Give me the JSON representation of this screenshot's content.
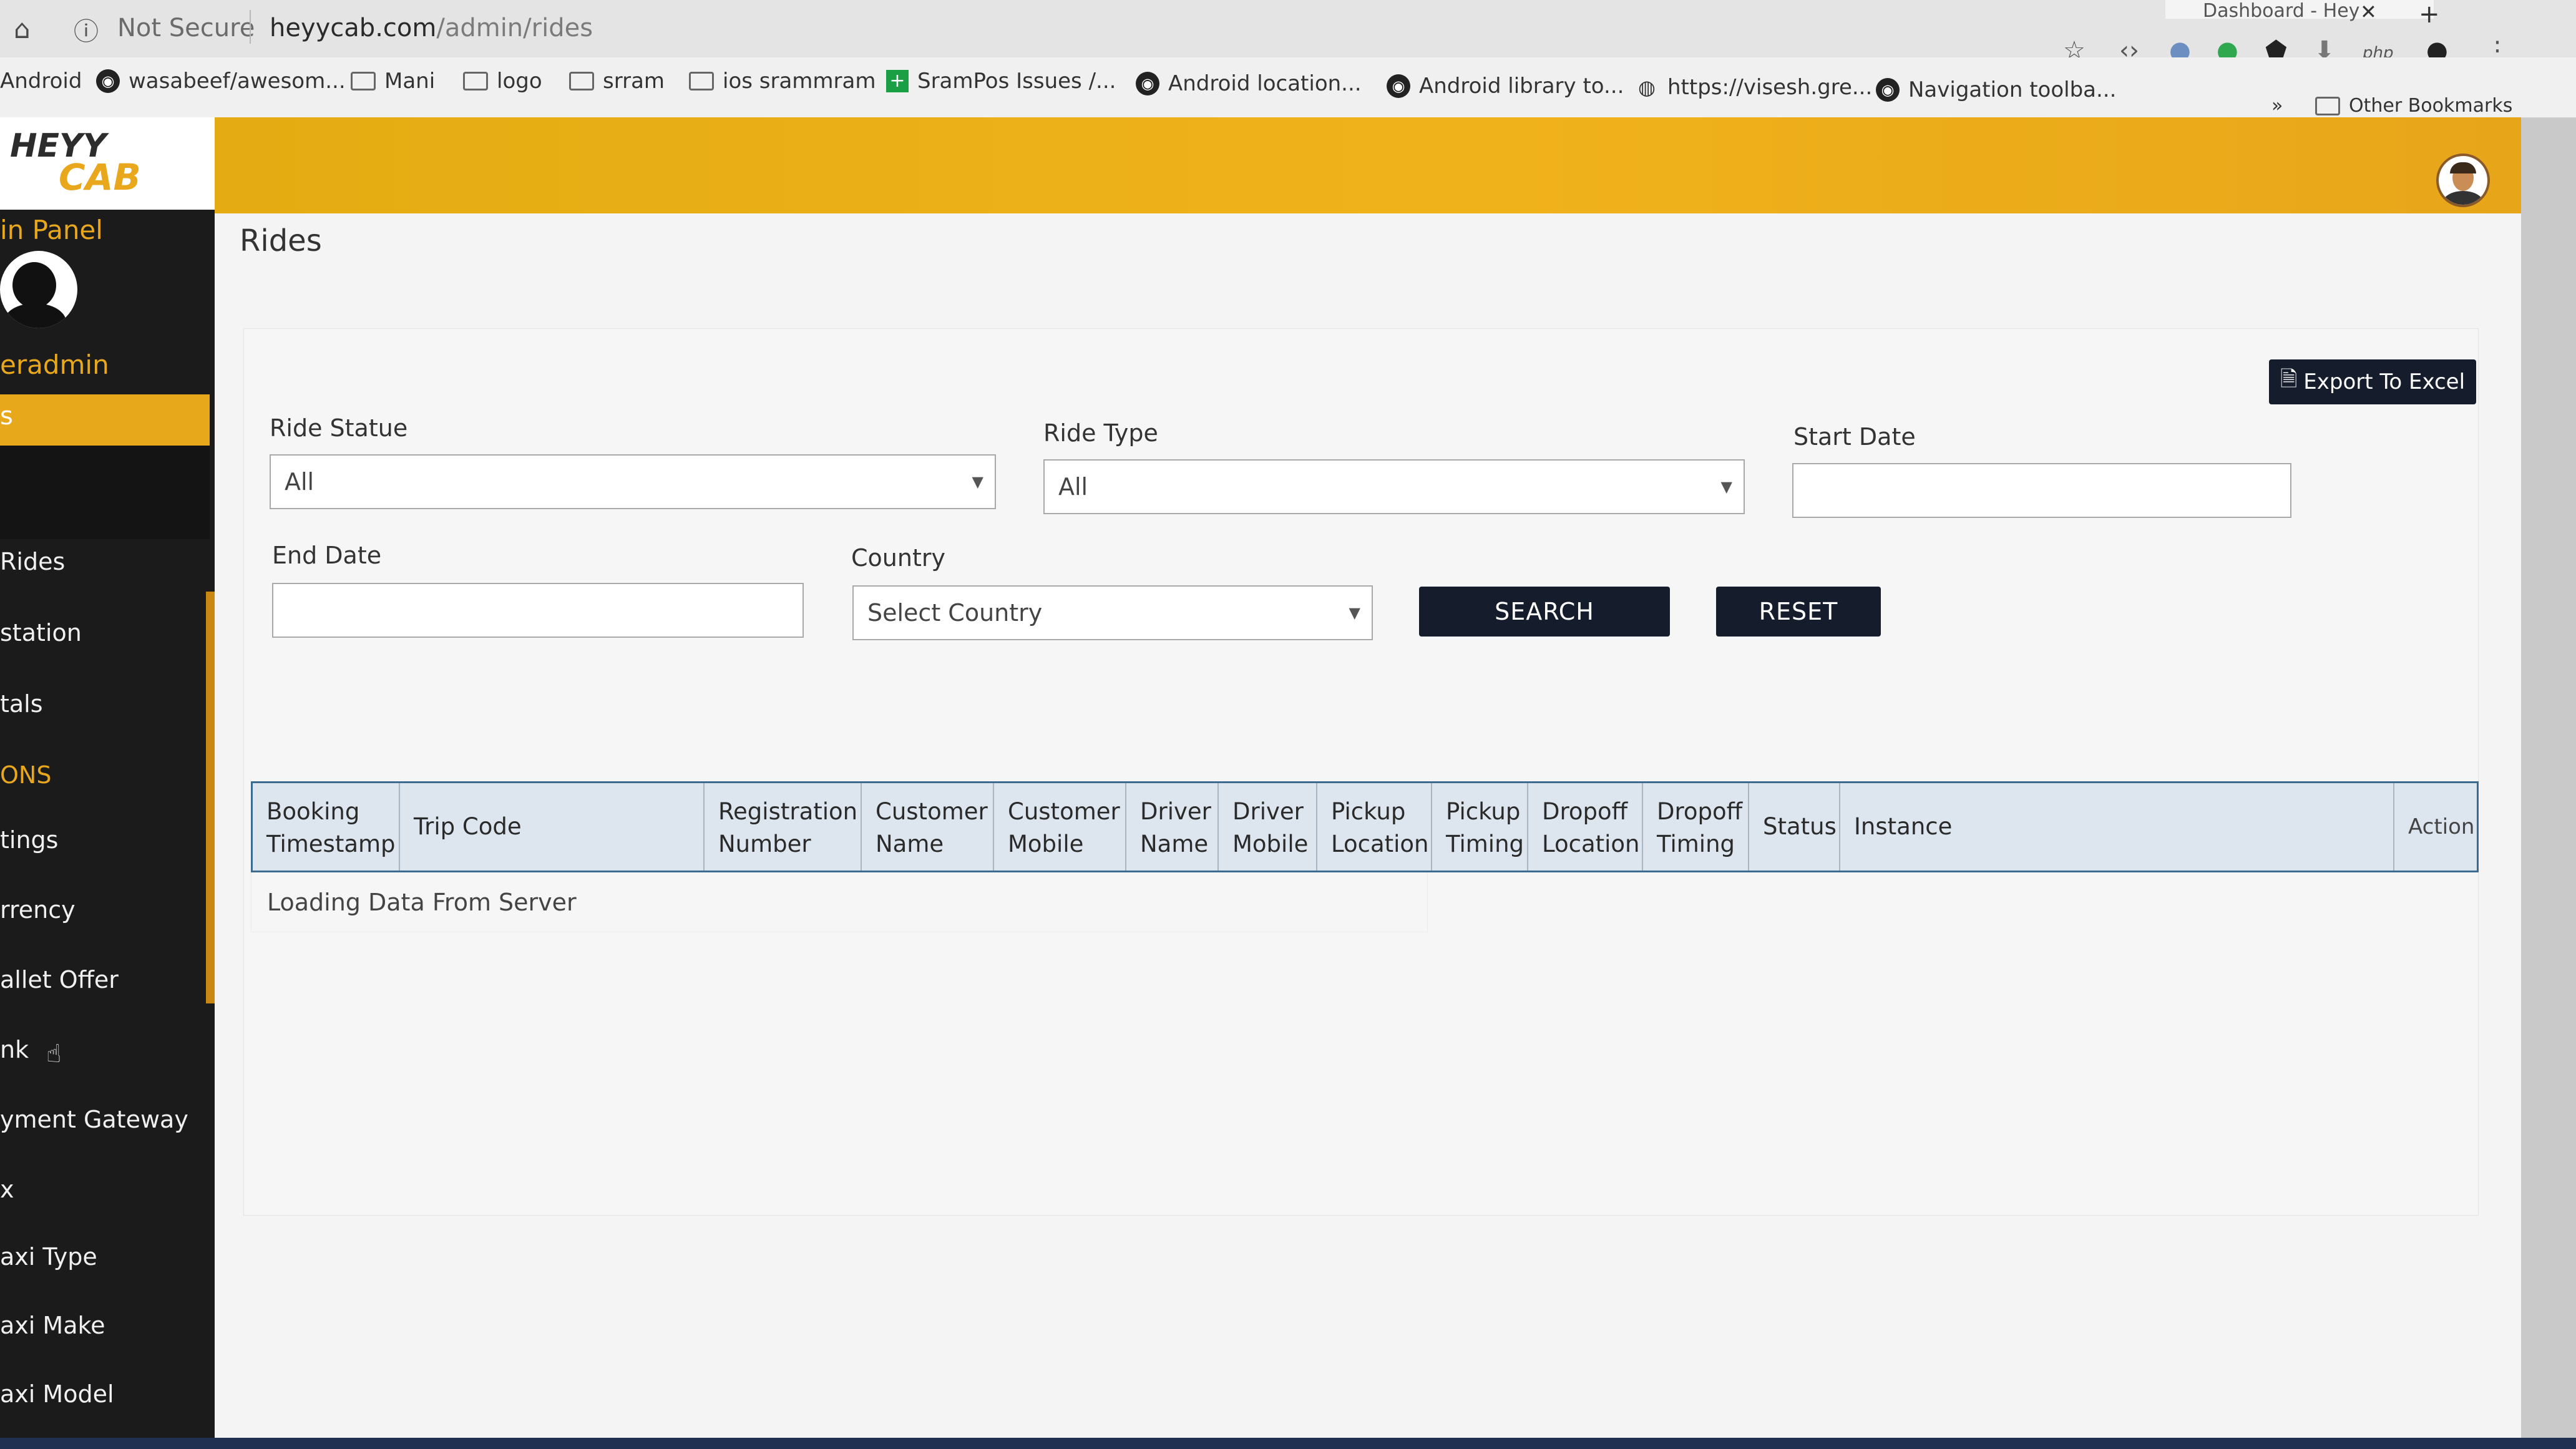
{
  "browser": {
    "security_label": "Not Secure",
    "url_host": "heyycab.com",
    "url_path": "/admin/rides",
    "active_tab_title": "Dashboard - Hey",
    "tab_close": "✕",
    "new_tab": "+"
  },
  "bookmarks": [
    {
      "label": "Android",
      "icon": "none"
    },
    {
      "label": "wasabeef/awesom...",
      "icon": "github-icon"
    },
    {
      "label": "Mani",
      "icon": "folder-icon"
    },
    {
      "label": "logo",
      "icon": "folder-icon"
    },
    {
      "label": "srram",
      "icon": "folder-icon"
    },
    {
      "label": "ios srammram",
      "icon": "folder-icon"
    },
    {
      "label": "SramPos Issues /...",
      "icon": "sheets-icon"
    },
    {
      "label": "Android location...",
      "icon": "github-icon"
    },
    {
      "label": "Android library to...",
      "icon": "github-icon"
    },
    {
      "label": "https://visesh.gre...",
      "icon": "globe-icon"
    },
    {
      "label": "Navigation toolba...",
      "icon": "github-icon"
    }
  ],
  "bookmarks_overflow": "»",
  "other_bookmarks": "Other Bookmarks",
  "extensions": {
    "php_label": "php"
  },
  "app": {
    "logo_top": "HEYY",
    "logo_bottom": "CAB",
    "panel_title": "in Panel",
    "username": "eradmin",
    "active_menu": "s",
    "menu": [
      {
        "label": "Rides",
        "color": "#f0f0f0"
      },
      {
        "label": "station",
        "color": "#f0f0f0"
      },
      {
        "label": "tals",
        "color": "#f0f0f0"
      },
      {
        "label": "ONS",
        "color": "#e9a81c"
      },
      {
        "label": "tings",
        "color": "#f0f0f0"
      },
      {
        "label": "rrency",
        "color": "#f0f0f0"
      },
      {
        "label": "allet Offer",
        "color": "#f0f0f0"
      },
      {
        "label": "nk",
        "color": "#f0f0f0"
      },
      {
        "label": "yment Gateway",
        "color": "#f0f0f0"
      },
      {
        "label": "x",
        "color": "#f0f0f0"
      },
      {
        "label": "axi Type",
        "color": "#f0f0f0"
      },
      {
        "label": "axi Make",
        "color": "#f0f0f0"
      },
      {
        "label": "axi Model",
        "color": "#f0f0f0"
      }
    ],
    "page_title": "Rides",
    "export_button": "Export To Excel",
    "filters": {
      "ride_status_label": "Ride Statue",
      "ride_status_value": "All",
      "ride_type_label": "Ride Type",
      "ride_type_value": "All",
      "start_date_label": "Start Date",
      "start_date_value": "",
      "end_date_label": "End Date",
      "end_date_value": "",
      "country_label": "Country",
      "country_value": "Select Country"
    },
    "search_button": "SEARCH",
    "reset_button": "RESET",
    "table": {
      "columns": [
        [
          "Booking",
          "Timestamp"
        ],
        [
          "Trip Code"
        ],
        [
          "Registration",
          "Number"
        ],
        [
          "Customer",
          "Name"
        ],
        [
          "Customer",
          "Mobile"
        ],
        [
          "Driver",
          "Name"
        ],
        [
          "Driver",
          "Mobile"
        ],
        [
          "Pickup",
          "Location"
        ],
        [
          "Pickup",
          "Timing"
        ],
        [
          "Dropoff",
          "Location"
        ],
        [
          "Dropoff",
          "Timing"
        ],
        [
          "Status"
        ],
        [
          "Instance"
        ],
        [
          "Action"
        ]
      ],
      "loading_text": "Loading Data From Server"
    }
  },
  "colors": {
    "accent": "#e9a81c",
    "sidebar_bg": "#1b1b1b",
    "button_dark": "#151c2c",
    "table_header_bg": "#dde6ee"
  }
}
